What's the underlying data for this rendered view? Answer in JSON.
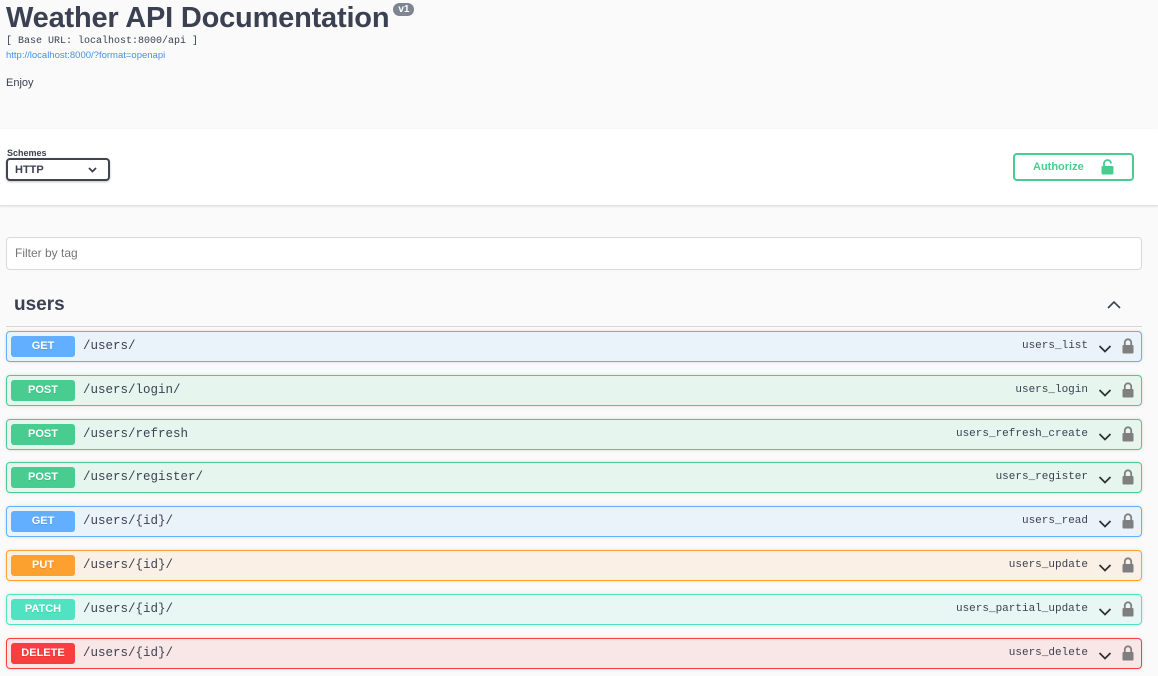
{
  "info": {
    "title": "Weather API Documentation",
    "version": "v1",
    "base_url": "[ Base URL: localhost:8000/api ]",
    "spec_link": "http://localhost:8000/?format=openapi",
    "description": "Enjoy"
  },
  "schemes": {
    "label": "Schemes",
    "selected": "HTTP",
    "icon": "chevron-down-icon"
  },
  "authorize": {
    "label": "Authorize",
    "icon": "unlocked-icon"
  },
  "filter": {
    "placeholder": "Filter by tag"
  },
  "tag": {
    "name": "users",
    "icon": "chevron-up-icon"
  },
  "operations": [
    {
      "method": "GET",
      "path": "/users/",
      "operation_id": "users_list"
    },
    {
      "method": "POST",
      "path": "/users/login/",
      "operation_id": "users_login"
    },
    {
      "method": "POST",
      "path": "/users/refresh",
      "operation_id": "users_refresh_create"
    },
    {
      "method": "POST",
      "path": "/users/register/",
      "operation_id": "users_register"
    },
    {
      "method": "GET",
      "path": "/users/{id}/",
      "operation_id": "users_read"
    },
    {
      "method": "PUT",
      "path": "/users/{id}/",
      "operation_id": "users_update"
    },
    {
      "method": "PATCH",
      "path": "/users/{id}/",
      "operation_id": "users_partial_update"
    },
    {
      "method": "DELETE",
      "path": "/users/{id}/",
      "operation_id": "users_delete"
    }
  ],
  "colors": {
    "get": "#61affe",
    "post": "#49cc90",
    "put": "#fca130",
    "patch": "#50e3c2",
    "delete": "#f93e3e",
    "lock": "#7f7f7f"
  }
}
